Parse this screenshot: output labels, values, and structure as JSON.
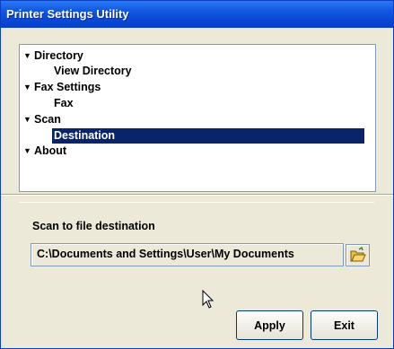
{
  "window": {
    "title": "Printer Settings Utility"
  },
  "tree": {
    "nodes": [
      {
        "label": "Directory",
        "expanded": true,
        "level": 0
      },
      {
        "label": "View Directory",
        "level": 1
      },
      {
        "label": "Fax Settings",
        "expanded": true,
        "level": 0
      },
      {
        "label": "Fax",
        "level": 1
      },
      {
        "label": "Scan",
        "expanded": true,
        "level": 0
      },
      {
        "label": "Destination",
        "level": 1,
        "selected": true
      },
      {
        "label": "About",
        "expanded": true,
        "level": 0
      }
    ]
  },
  "scan": {
    "label": "Scan to file destination",
    "path": "C:\\Documents and Settings\\User\\My Documents"
  },
  "buttons": {
    "apply": "Apply",
    "exit": "Exit"
  },
  "icons": {
    "browse": "folder-open-icon",
    "cursor": "mouse-pointer-icon",
    "expand": "triangle-down-icon"
  },
  "colors": {
    "titlebar": "#0a48d6",
    "selection": "#0a246a",
    "window": "#ece9d8"
  }
}
